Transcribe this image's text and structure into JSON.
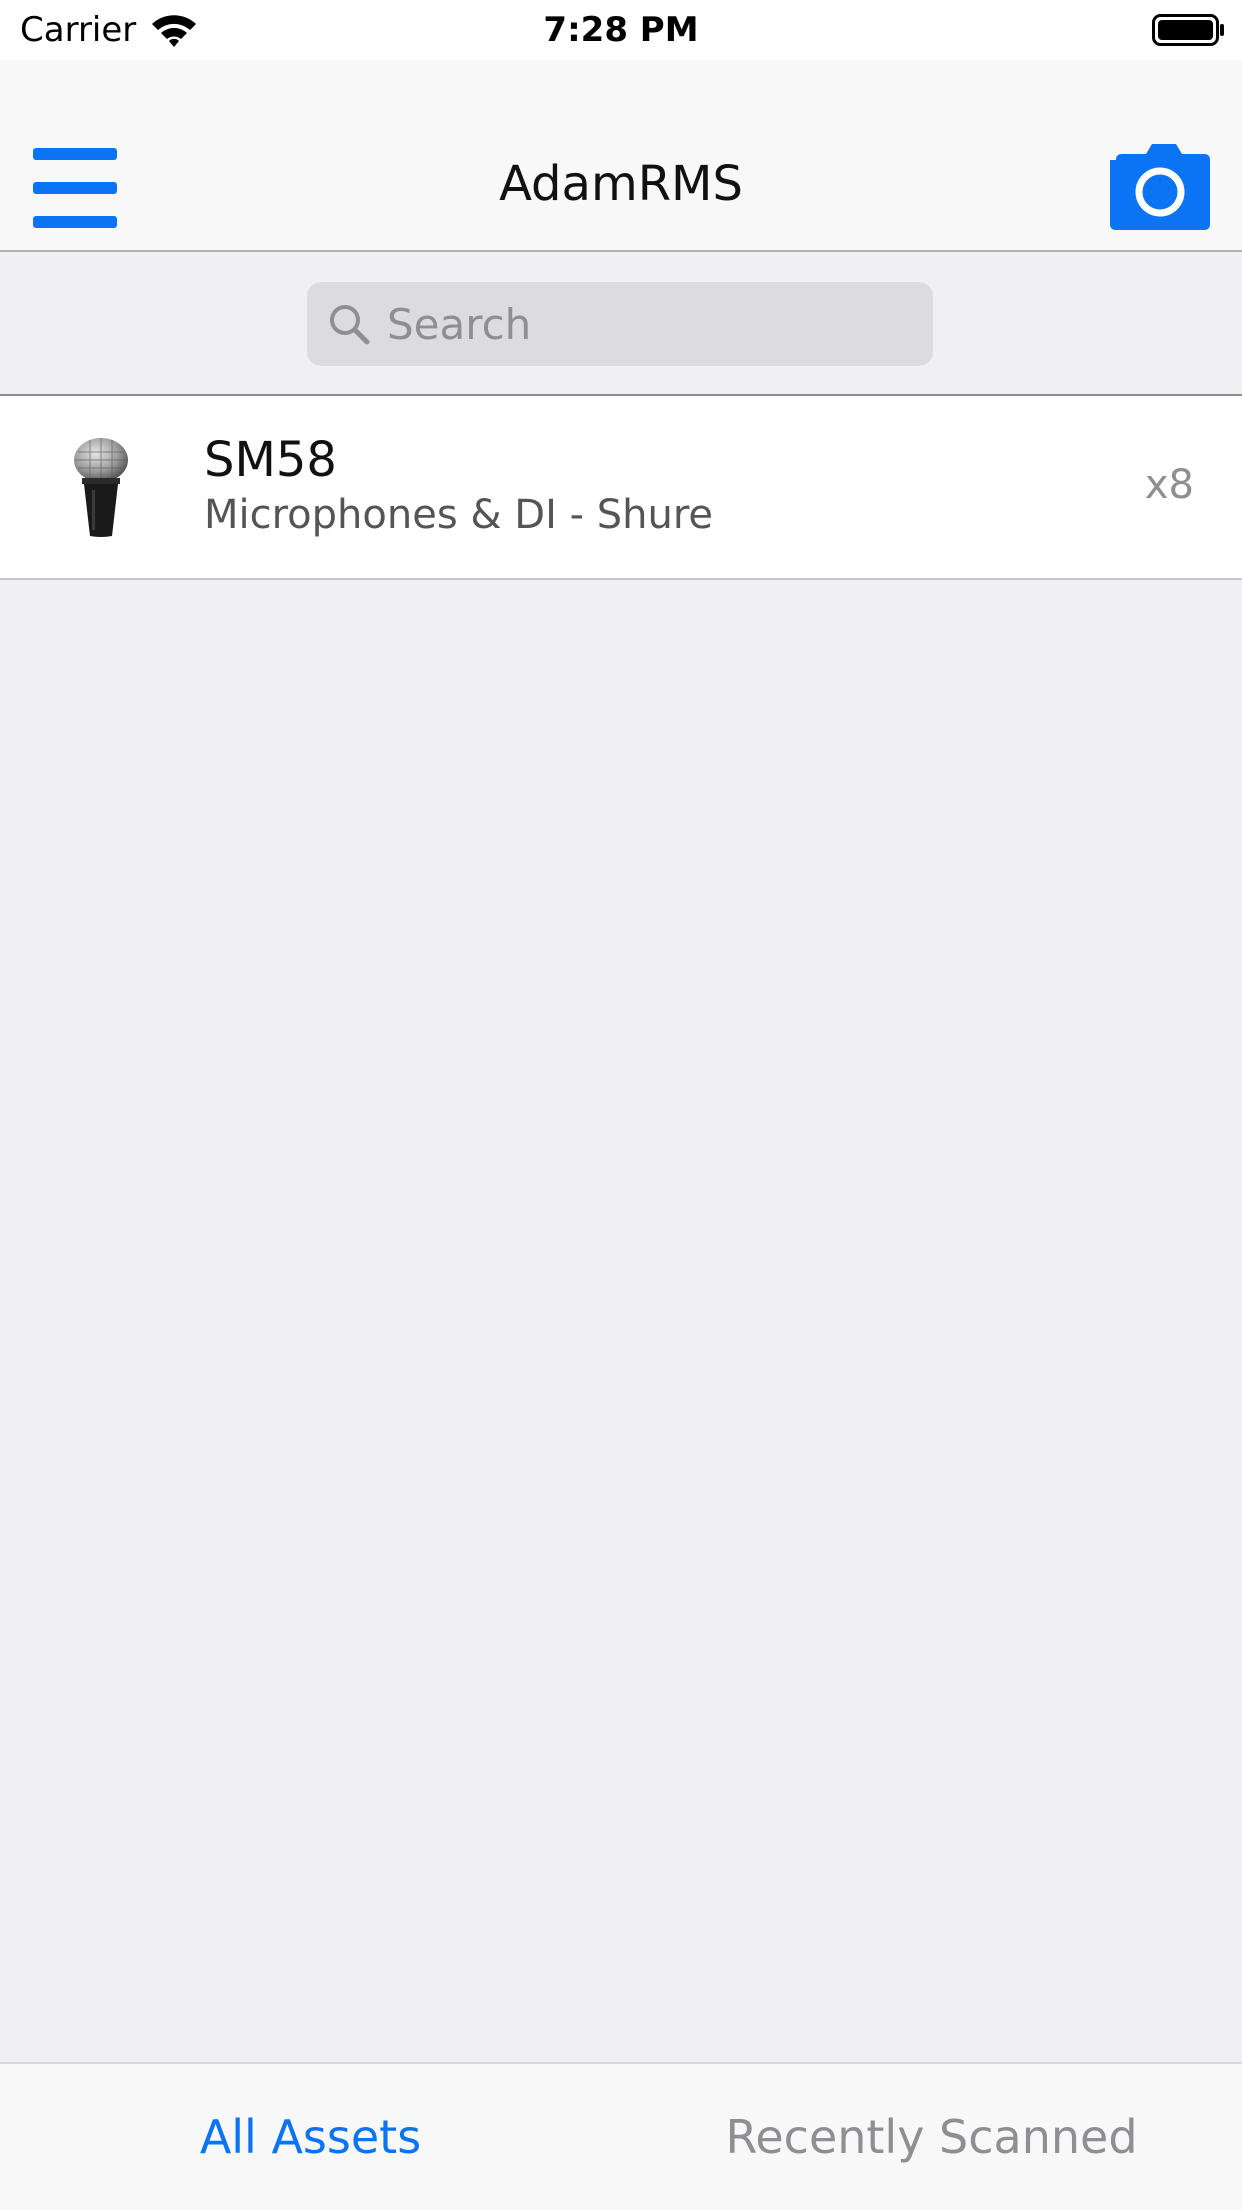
{
  "status_bar": {
    "carrier": "Carrier",
    "time": "7:28 PM",
    "wifi_icon": "wifi-icon",
    "battery_icon": "battery-full-icon"
  },
  "nav": {
    "title": "AdamRMS",
    "menu_icon": "hamburger-menu-icon",
    "camera_icon": "camera-icon",
    "accent_color": "#0A74F5"
  },
  "search": {
    "placeholder": "Search",
    "value": ""
  },
  "assets": [
    {
      "name": "SM58",
      "subtitle": "Microphones & DI - Shure",
      "count": "x8",
      "thumbnail": "microphone-thumbnail"
    }
  ],
  "tabs": [
    {
      "label": "All Assets",
      "selected": true
    },
    {
      "label": "Recently Scanned",
      "selected": false
    }
  ],
  "colors": {
    "tab_active": "#0A74F5",
    "tab_inactive": "#8E8E93",
    "background": "#EFEFF4"
  }
}
